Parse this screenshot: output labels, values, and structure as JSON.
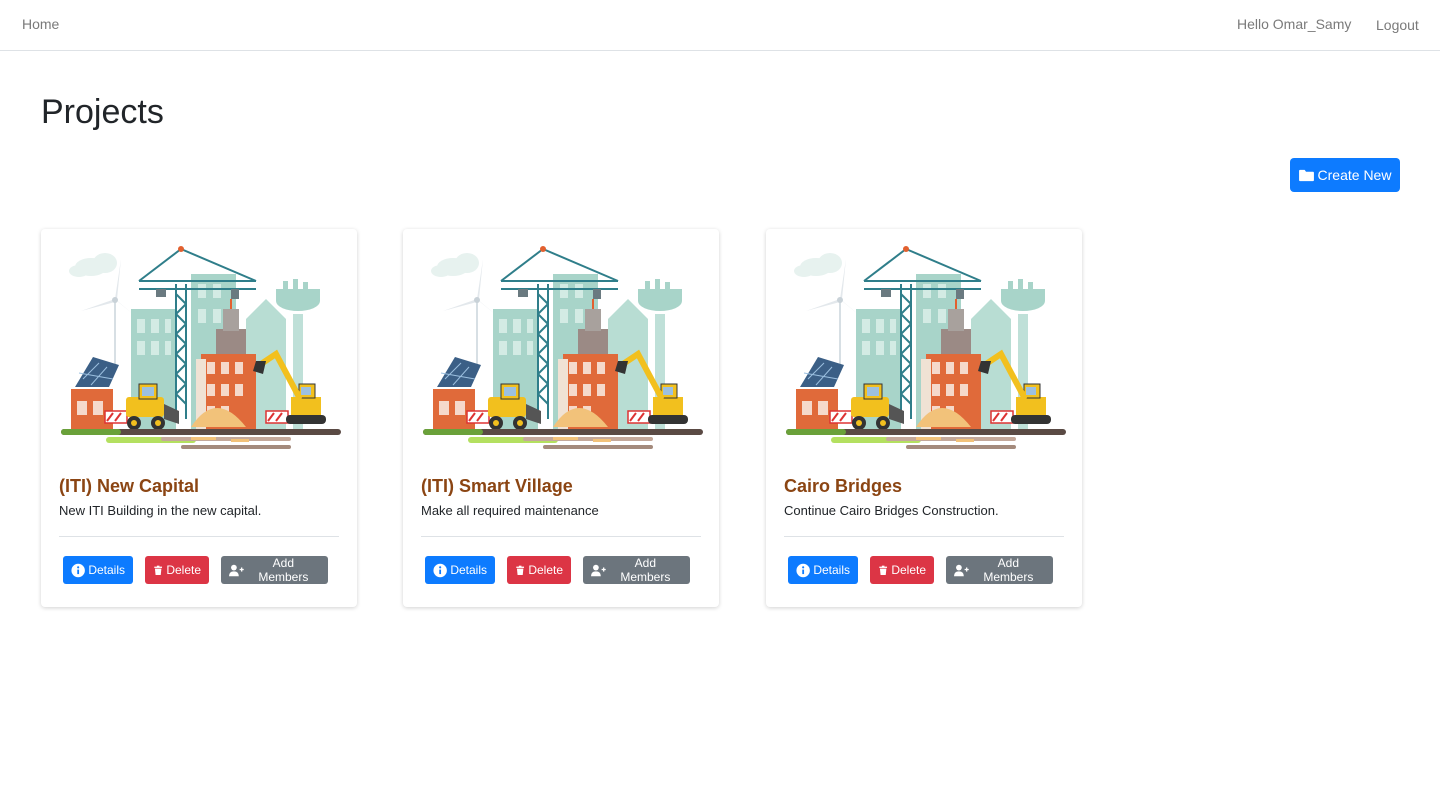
{
  "nav": {
    "home_label": "Home",
    "greeting": "Hello Omar_Samy",
    "logout_label": "Logout"
  },
  "page": {
    "title": "Projects",
    "create_label": "Create New"
  },
  "actions": {
    "details_label": "Details",
    "delete_label": "Delete",
    "add_members_label": "Add Members"
  },
  "projects": [
    {
      "title": "(ITI) New Capital",
      "description": "New ITI Building in the new capital.",
      "image": "construction-illustration"
    },
    {
      "title": "(ITI) Smart Village",
      "description": "Make all required maintenance",
      "image": "construction-illustration"
    },
    {
      "title": "Cairo Bridges",
      "description": "Continue Cairo Bridges Construction.",
      "image": "construction-illustration"
    }
  ],
  "colors": {
    "primary": "#0d7bff",
    "danger": "#dc3545",
    "secondary": "#6c757d",
    "project_title": "#8b4513"
  }
}
